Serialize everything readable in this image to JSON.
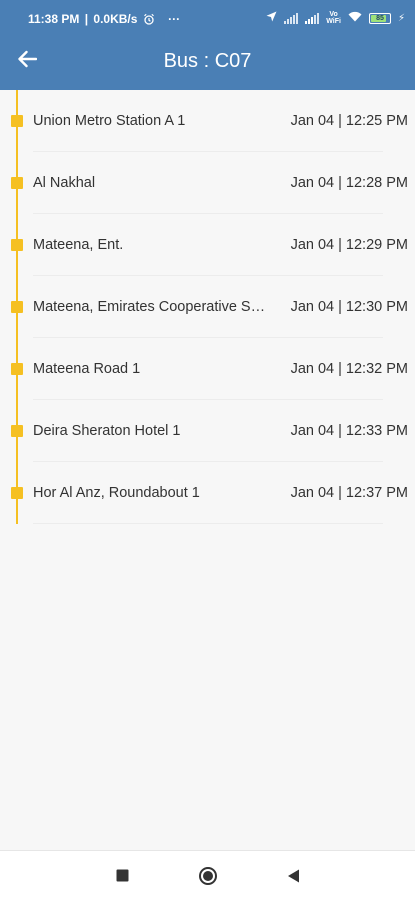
{
  "status_bar": {
    "time": "11:38 PM",
    "network_speed": "0.0KB/s",
    "more": "···",
    "volte_top": "Vo",
    "volte_bottom": "WiFi",
    "battery": "85"
  },
  "header": {
    "title": "Bus : C07",
    "back_icon": "arrow-left-icon"
  },
  "colors": {
    "header_bg": "#4a7fb5",
    "timeline_accent": "#f5c022"
  },
  "stops": [
    {
      "name": "Union Metro Station A 1",
      "time": "Jan 04 | 12:25 PM"
    },
    {
      "name": "Al Nakhal",
      "time": "Jan 04 | 12:28 PM"
    },
    {
      "name": "Mateena, Ent.",
      "time": "Jan 04 | 12:29 PM"
    },
    {
      "name": "Mateena, Emirates Cooperative Society",
      "time": "Jan 04 | 12:30 PM"
    },
    {
      "name": "Mateena Road 1",
      "time": "Jan 04 | 12:32 PM"
    },
    {
      "name": "Deira Sheraton Hotel 1",
      "time": "Jan 04 | 12:33 PM"
    },
    {
      "name": "Hor Al Anz, Roundabout 1",
      "time": "Jan 04 | 12:37 PM"
    }
  ],
  "nav_bar": {
    "recents_icon": "square-icon",
    "home_icon": "circle-icon",
    "back_icon": "triangle-back-icon"
  }
}
